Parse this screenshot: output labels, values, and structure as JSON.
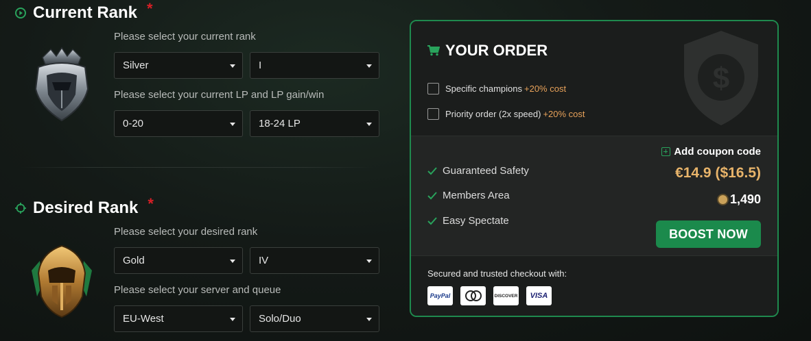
{
  "current": {
    "title": "Current Rank",
    "required_mark": "*",
    "rank_label": "Please select your current rank",
    "rank_value": "Silver",
    "division_value": "I",
    "lp_label": "Please select your current LP and LP gain/win",
    "lp_value": "0-20",
    "lp_gain_value": "18-24 LP"
  },
  "desired": {
    "title": "Desired Rank",
    "required_mark": "*",
    "rank_label": "Please select your desired rank",
    "rank_value": "Gold",
    "division_value": "IV",
    "server_label": "Please select your server and queue",
    "server_value": "EU-West",
    "queue_value": "Solo/Duo"
  },
  "order": {
    "title": "YOUR ORDER",
    "options": [
      {
        "label": "Specific champions",
        "extra": "+20% cost"
      },
      {
        "label": "Priority order (2x speed)",
        "extra": "+20% cost"
      }
    ],
    "features": [
      "Guaranteed Safety",
      "Members Area",
      "Easy Spectate"
    ],
    "coupon_label": "Add coupon code",
    "price": "€14.9 ($16.5)",
    "coins": "1,490",
    "boost_button": "BOOST NOW",
    "secured_text": "Secured and trusted checkout with:",
    "payment_methods": [
      "PayPal",
      "Mastercard",
      "DISCOVER",
      "VISA"
    ]
  },
  "colors": {
    "accent_green": "#1b8a4c",
    "price_gold": "#e8b46a",
    "extra_orange": "#e8a25a",
    "required_red": "#d81f26"
  }
}
